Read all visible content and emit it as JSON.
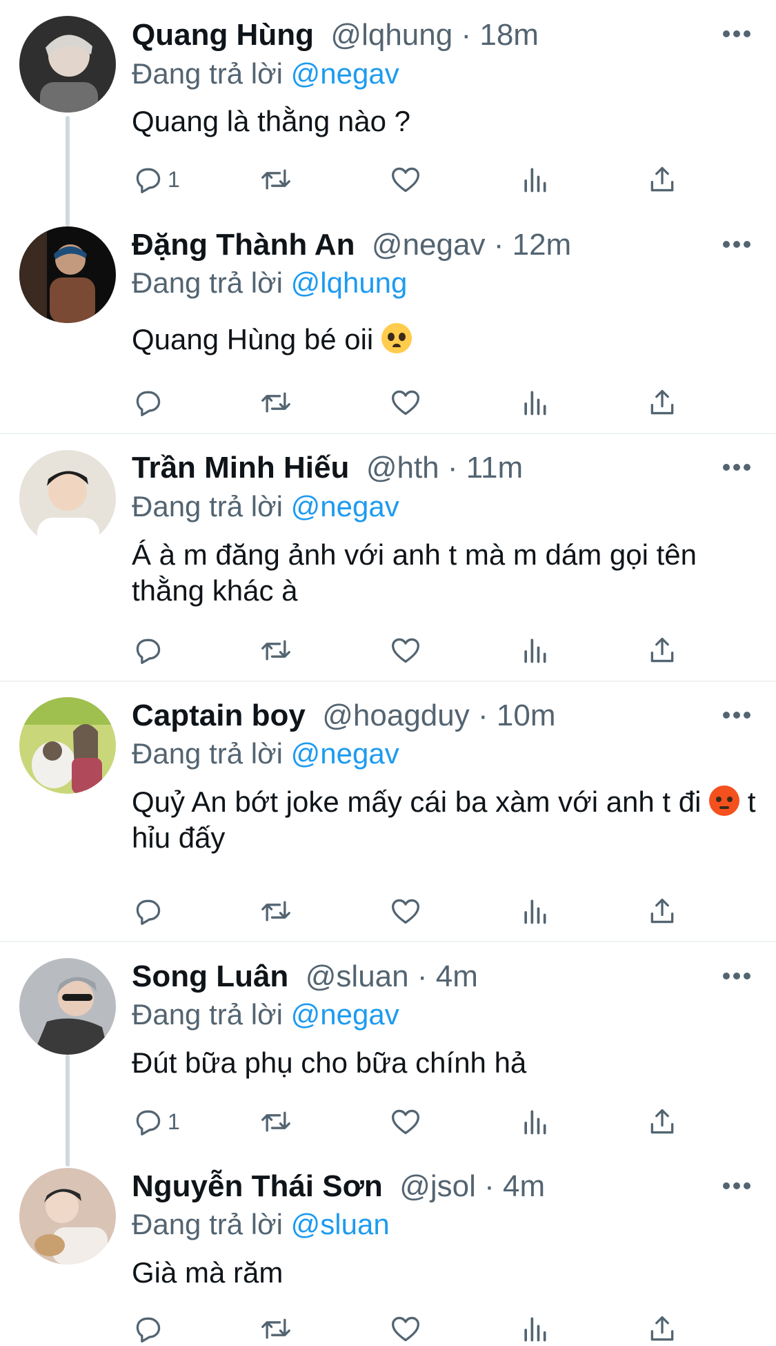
{
  "reply_prefix": "Đang trả lời",
  "sep": "·",
  "tweets": [
    {
      "name": "Quang Hùng",
      "handle": "@lqhung",
      "time": "18m",
      "mention": "@negav",
      "text": "Quang là thằng nào ?",
      "reply_count": "1",
      "avatar_colors": [
        "#d9d6d2",
        "#2b2b2b"
      ]
    },
    {
      "name": "Đặng Thành An",
      "handle": "@negav",
      "time": "12m",
      "mention": "@lqhung",
      "text": "Quang Hùng bé oii",
      "emoji": "pleading-face",
      "reply_count": "",
      "avatar_colors": [
        "#0d0d0d",
        "#7a4a35"
      ]
    },
    {
      "name": "Trần Minh Hiếu",
      "handle": "@hth",
      "time": "11m",
      "mention": "@negav",
      "text": "Á à m đăng ảnh với anh t mà m dám gọi tên thằng khác à",
      "reply_count": "",
      "avatar_colors": [
        "#e7e2da",
        "#1e1e1e"
      ]
    },
    {
      "name": "Captain boy",
      "handle": "@hoagduy",
      "time": "10m",
      "mention": "@negav",
      "text": "Quỷ An bớt joke mấy cái ba xàm với anh t đi",
      "emoji": "angry-face",
      "text_after": "t hỉu đấy",
      "reply_count": "",
      "avatar_colors": [
        "#c9d77a",
        "#6b5b4d"
      ]
    },
    {
      "name": "Song Luân",
      "handle": "@sluan",
      "time": "4m",
      "mention": "@negav",
      "text": "Đút bữa phụ cho bữa chính hả",
      "reply_count": "1",
      "avatar_colors": [
        "#9aa0a6",
        "#3a3a3a"
      ]
    },
    {
      "name": "Nguyễn Thái Sơn",
      "handle": "@jsol",
      "time": "4m",
      "mention": "@sluan",
      "text": "Già mà răm",
      "reply_count": "",
      "avatar_colors": [
        "#d8c3b5",
        "#f2ede8"
      ]
    }
  ],
  "icons": {
    "reply": "reply-icon",
    "retweet": "retweet-icon",
    "like": "like-icon",
    "views": "views-icon",
    "share": "share-icon",
    "more": "more-icon"
  },
  "colors": {
    "accent": "#1d9bf0",
    "secondary_text": "#536471",
    "divider": "#eff3f4"
  }
}
